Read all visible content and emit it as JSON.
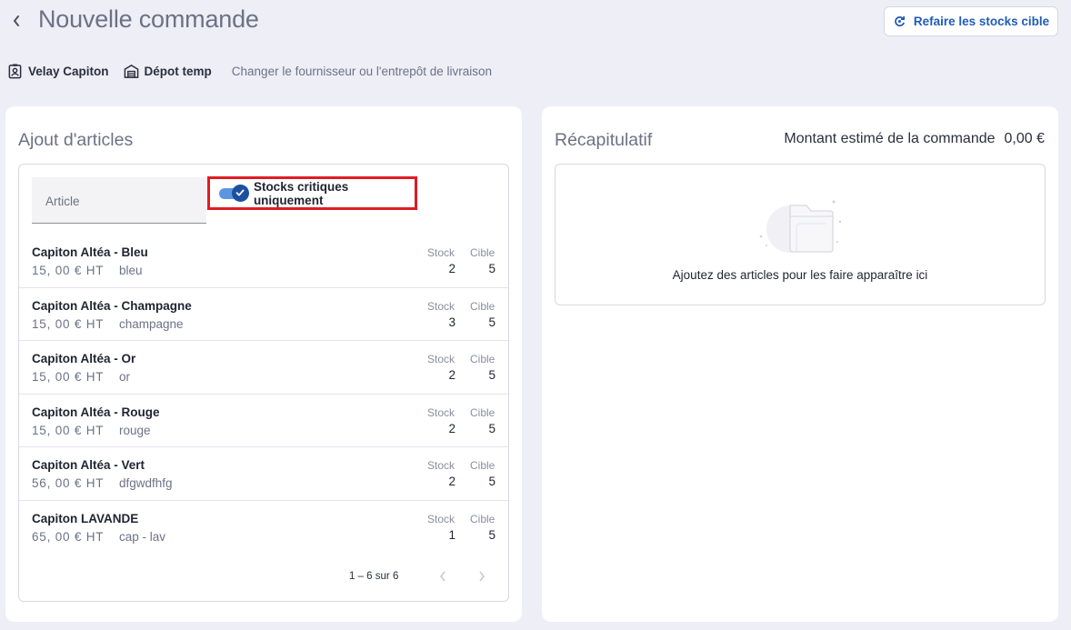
{
  "header": {
    "back_icon": "chevron-left-icon",
    "title": "Nouvelle commande",
    "redo_button_label": "Refaire les stocks cible",
    "redo_icon": "refresh-icon"
  },
  "supplier": {
    "supplier_name": "Velay Capiton",
    "supplier_icon": "badge-icon",
    "warehouse_name": "Dépot temp",
    "warehouse_icon": "warehouse-icon",
    "change_link": "Changer le fournisseur ou l'entrepôt de livraison"
  },
  "add_panel": {
    "title": "Ajout d'articles",
    "search_label": "Article",
    "toggle_label": "Stocks critiques uniquement",
    "toggle_on": true,
    "col_stock": "Stock",
    "col_cible": "Cible",
    "items": [
      {
        "name": "Capiton Altéa - Bleu",
        "price": "15, 00 € HT",
        "ref": "bleu",
        "stock": "2",
        "cible": "5"
      },
      {
        "name": "Capiton Altéa - Champagne",
        "price": "15, 00 € HT",
        "ref": "champagne",
        "stock": "3",
        "cible": "5"
      },
      {
        "name": "Capiton Altéa - Or",
        "price": "15, 00 € HT",
        "ref": "or",
        "stock": "2",
        "cible": "5"
      },
      {
        "name": "Capiton Altéa - Rouge",
        "price": "15, 00 € HT",
        "ref": "rouge",
        "stock": "2",
        "cible": "5"
      },
      {
        "name": "Capiton Altéa - Vert",
        "price": "56, 00 € HT",
        "ref": "dfgwdfhfg",
        "stock": "2",
        "cible": "5"
      },
      {
        "name": "Capiton LAVANDE",
        "price": "65, 00 € HT",
        "ref": "cap - lav",
        "stock": "1",
        "cible": "5"
      }
    ],
    "pagination": "1 – 6 sur 6",
    "prev_icon": "chevron-left-icon",
    "next_icon": "chevron-right-icon"
  },
  "summary_panel": {
    "title": "Récapitulatif",
    "amount_label": "Montant estimé de la commande",
    "amount_value": "0,00 €",
    "empty_icon": "folder-icon",
    "empty_text": "Ajoutez des articles pour les faire apparaître ici"
  },
  "colors": {
    "accent": "#1f5cb8",
    "toggle_track": "#5d96e0",
    "toggle_knob": "#1d4f9e",
    "highlight_border": "#e01b24",
    "background": "#eeeef6"
  }
}
